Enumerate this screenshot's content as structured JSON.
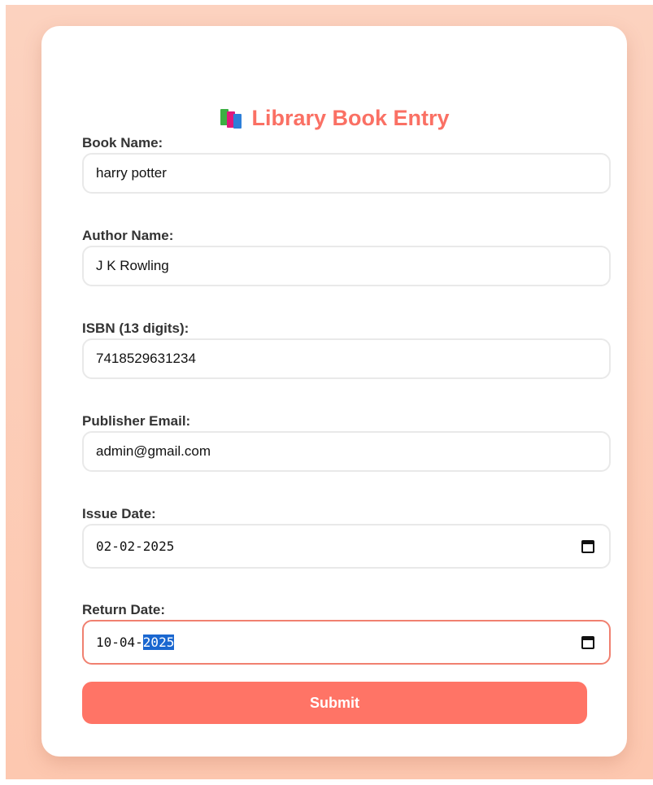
{
  "title": {
    "icon": "books-icon",
    "text": "Library Book Entry"
  },
  "fields": {
    "book_name": {
      "label": "Book Name:",
      "value": "harry potter"
    },
    "author_name": {
      "label": "Author Name:",
      "value": "J K Rowling"
    },
    "isbn": {
      "label": "ISBN (13 digits):",
      "value": "7418529631234"
    },
    "publisher_email": {
      "label": "Publisher Email:",
      "value": "admin@gmail.com"
    },
    "issue_date": {
      "label": "Issue Date:",
      "value": "02-02-2025",
      "icon": "calendar-icon"
    },
    "return_date": {
      "label": "Return Date:",
      "value_prefix": "10-04-",
      "value_selected": "2025",
      "icon": "calendar-icon"
    }
  },
  "submit_label": "Submit",
  "colors": {
    "accent": "#fa7064",
    "button": "#ff7466",
    "background": "#fcd2bf",
    "selection": "#1a67d0"
  }
}
